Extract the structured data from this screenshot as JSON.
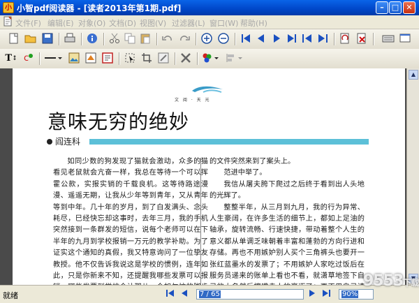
{
  "window": {
    "title": "小智pdf阅读器 - [读者2013年第1期.pdf]"
  },
  "menu": [
    {
      "label": "文件(F)"
    },
    {
      "label": "编辑(E)"
    },
    {
      "label": "对象(O)"
    },
    {
      "label": "文档(D)"
    },
    {
      "label": "视图(V)"
    },
    {
      "label": "过滤器(L)"
    },
    {
      "label": "窗口(W)"
    },
    {
      "label": "帮助(H)"
    }
  ],
  "article": {
    "kicker": "文 阅 · 天 光",
    "headline": "意味无穷的绝妙",
    "author": "阎连科",
    "left_paragraphs": [
      "如同少数的狗发现了猫就会激动，众多的猫看见老鼠就会亢奋一样，我总在等待一个可以挥霍公款，实报实销的千载良机。这等待路途漫漫、遥遥无期，让我从少年等到青年，又从青年等到中年。几十年的岁月，到了白发满头、念头耗尽，巳经快忘却这事时，去年三月，我的手机突然接到一条群发的短信，说每个老师可以在下半年的九月到学校报销一万元的教学补助。为了证实这个通知的真假，我又特意询问了一位挚友教授。他不仅告诉我说这是学校的惯例，连年如此，只是你新来不知，还提醒我哪些发票可以报销，哪些发票到学校会计那儿，会如匆忙的脚步突然走到了一条死"
    ],
    "right_paragraphs": [
      "的文件突然来到了案头上。",
      "范进中举了。",
      "我信从屠夫胯下爬过之后终于看到出人头地的光辉了。",
      "整整半年，从三月到九月，我的行为异常、人生豪阔，在许多生活的细节上，都如上足油的轴承，旋转流畅、行速快捷，带动着整个人生的意义都从单调乏味朝着丰富和蓬勃的方向行进和存储。再也不用嫉妒别人买个三角裤头也要开一张红蓝墨水的发票了；不用嫉妒人家吃过饭后在服务员递来的账单上看也不看，就潇草地签下自己的大名然后擦嘴走人的豪迈了；更不用自己请人吃饭之后，还要把发票装在自己的钱包里，等待那张发票的名字"
    ]
  },
  "statusbar": {
    "status": "就绪",
    "page_indicator": "7 / 65",
    "zoom": "90%"
  },
  "watermark": {
    "text": "9553",
    "suffix": "下载"
  },
  "colors": {
    "accent_bar": "#5cc0d8",
    "title_bar": "#0a5ae0",
    "nav_blue": "#1a50c0"
  }
}
